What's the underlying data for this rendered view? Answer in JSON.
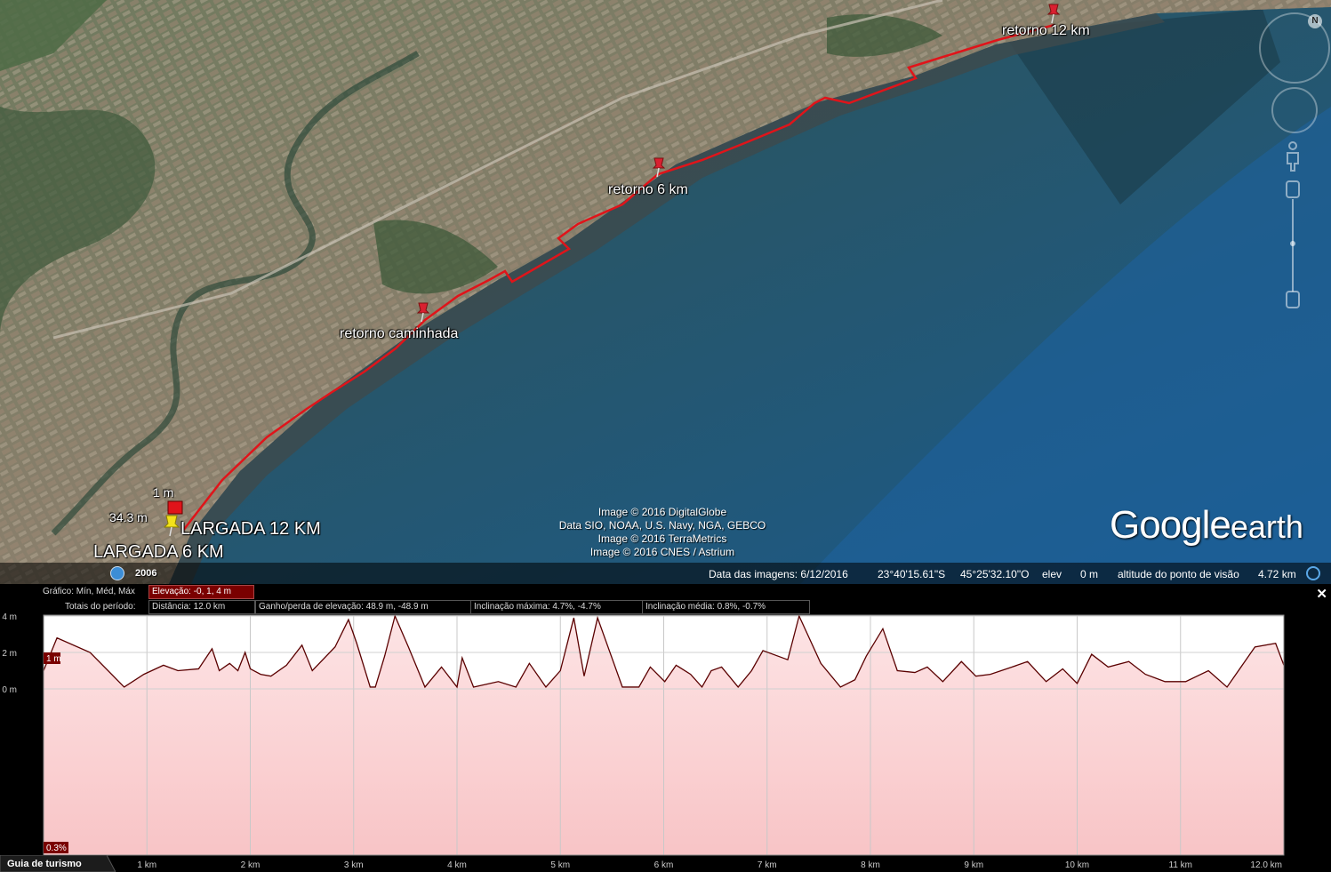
{
  "map": {
    "placemarks": [
      {
        "label": "retorno 12 km"
      },
      {
        "label": "retorno 6 km"
      },
      {
        "label": "retorno caminhada"
      },
      {
        "label": "LARGADA 12 KM"
      },
      {
        "label": "LARGADA 6 KM"
      }
    ],
    "cursor_labels": {
      "top": "1 m",
      "left": "34.3 m"
    },
    "credits": [
      "Image © 2016 DigitalGlobe",
      "Data SIO, NOAA, U.S. Navy, NGA, GEBCO",
      "Image © 2016 TerraMetrics",
      "Image © 2016 CNES / Astrium"
    ],
    "logo": {
      "google": "Google",
      "earth": "earth"
    },
    "historical_year": "2006",
    "route_color": "#e0141a"
  },
  "status": {
    "imagery_date_label": "Data das imagens: 6/12/2016",
    "lat": "23°40'15.61\"S",
    "lon": "45°25'32.10\"O",
    "elev_label": "elev",
    "elev_value": "0 m",
    "eye_alt_label": "altitude do ponto de visão",
    "eye_alt_value": "4.72 km"
  },
  "nav": {
    "north": "N"
  },
  "profile": {
    "close": "✕",
    "graph_label": "Gráfico: Mín, Méd, Máx",
    "elevation_box": "Elevação: -0, 1, 4 m",
    "totals_label": "Totais do período:",
    "distance_box": "Distância: 12.0 km",
    "gain_box": "Ganho/perda de elevação: 48.9 m, -48.9 m",
    "max_slope_box": "Inclinação máxima: 4.7%, -4.7%",
    "avg_slope_box": "Inclinação média: 0.8%, -0.7%",
    "tour_guide": "Guia de turismo",
    "cursor_elev_tag": "1 m",
    "cursor_slope_tag": "0.3%"
  },
  "chart_data": {
    "type": "area",
    "x_unit": "km",
    "x_ticks": [
      "1 km",
      "2 km",
      "3 km",
      "4 km",
      "5 km",
      "6 km",
      "7 km",
      "8 km",
      "9 km",
      "10 km",
      "11 km",
      "12.0 km"
    ],
    "y_ticks": [
      "4 m",
      "2 m",
      "0 m"
    ],
    "xlim": [
      0,
      12.0
    ],
    "ylim": [
      0,
      4
    ],
    "grid": true,
    "fill_color": "#f8c4c6",
    "line_color": "#5a0000",
    "x": [
      0.0,
      0.13,
      0.45,
      0.78,
      0.97,
      1.16,
      1.3,
      1.5,
      1.63,
      1.7,
      1.8,
      1.88,
      1.95,
      2.0,
      2.1,
      2.2,
      2.35,
      2.5,
      2.6,
      2.82,
      2.95,
      3.03,
      3.16,
      3.21,
      3.3,
      3.4,
      3.53,
      3.69,
      3.85,
      4.0,
      4.05,
      4.16,
      4.4,
      4.57,
      4.7,
      4.86,
      5.0,
      5.13,
      5.23,
      5.36,
      5.6,
      5.76,
      5.87,
      6.01,
      6.12,
      6.26,
      6.37,
      6.46,
      6.56,
      6.72,
      6.85,
      6.96,
      7.2,
      7.31,
      7.52,
      7.71,
      7.85,
      7.96,
      8.12,
      8.26,
      8.43,
      8.55,
      8.7,
      8.88,
      9.02,
      9.16,
      9.37,
      9.52,
      9.7,
      9.86,
      10.0,
      10.14,
      10.3,
      10.5,
      10.66,
      10.85,
      11.05,
      11.27,
      11.45,
      11.72,
      11.92,
      12.0
    ],
    "y": [
      1.0,
      2.8,
      2.0,
      0.1,
      0.8,
      1.3,
      1.0,
      1.1,
      2.2,
      1.0,
      1.4,
      1.0,
      2.0,
      1.1,
      0.8,
      0.7,
      1.3,
      2.4,
      1.0,
      2.3,
      3.8,
      2.5,
      0.1,
      0.1,
      1.8,
      4.0,
      2.3,
      0.1,
      1.2,
      0.1,
      1.7,
      0.1,
      0.4,
      0.1,
      1.4,
      0.1,
      1.0,
      3.9,
      0.7,
      3.9,
      0.1,
      0.1,
      1.2,
      0.4,
      1.3,
      0.8,
      0.1,
      1.0,
      1.2,
      0.1,
      1.0,
      2.1,
      1.6,
      4.0,
      1.4,
      0.1,
      0.5,
      1.8,
      3.3,
      1.0,
      0.9,
      1.2,
      0.4,
      1.5,
      0.7,
      0.8,
      1.2,
      1.5,
      0.4,
      1.1,
      0.3,
      1.9,
      1.2,
      1.5,
      0.8,
      0.4,
      0.4,
      1.0,
      0.1,
      2.3,
      2.5,
      1.3
    ]
  }
}
